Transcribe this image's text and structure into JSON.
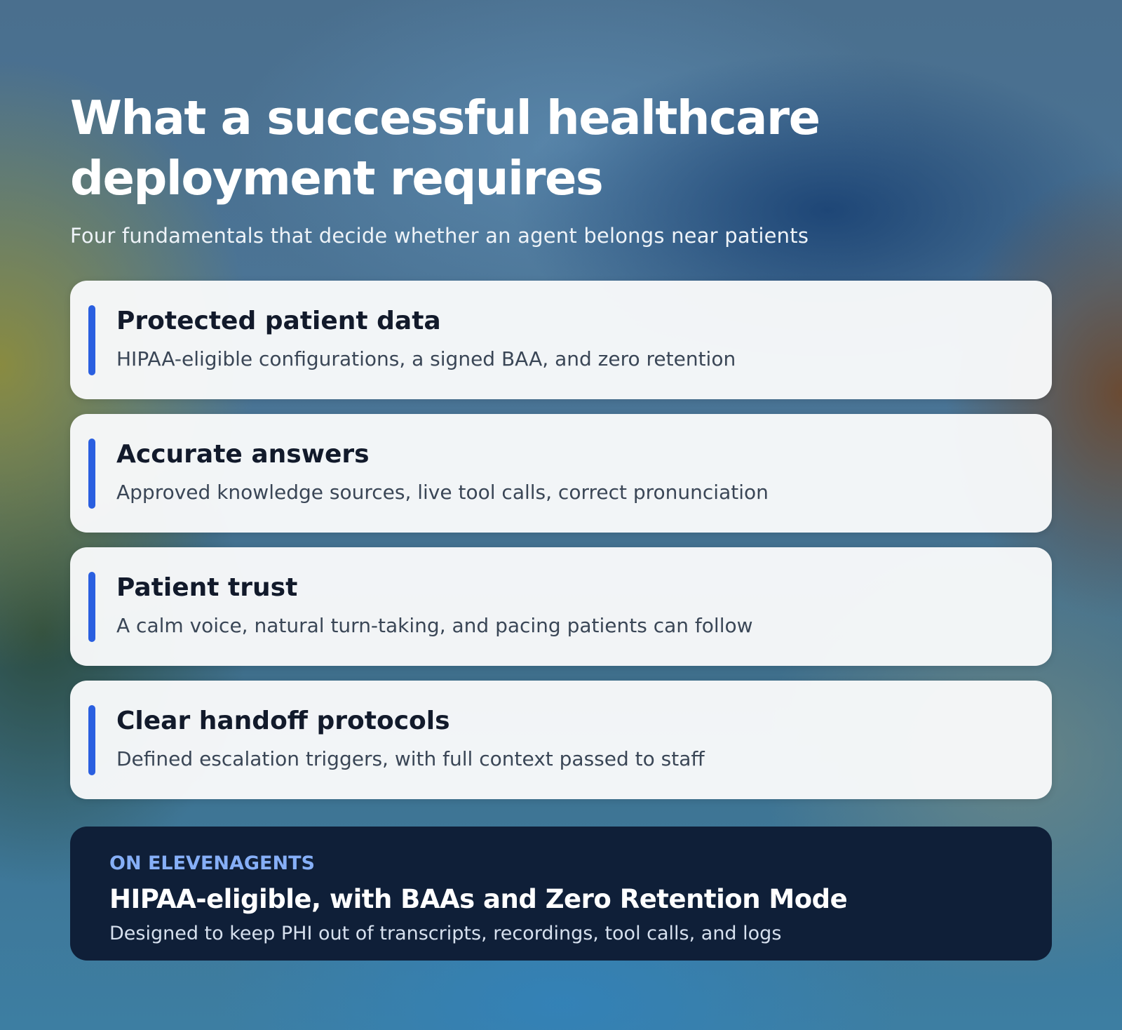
{
  "header": {
    "title": "What a successful healthcare deployment requires",
    "subtitle": "Four fundamentals that decide whether an agent belongs near patients"
  },
  "cards": [
    {
      "title": "Protected patient data",
      "description": "HIPAA-eligible configurations, a signed BAA, and zero retention"
    },
    {
      "title": "Accurate answers",
      "description": "Approved knowledge sources, live tool calls, correct pronunciation"
    },
    {
      "title": "Patient trust",
      "description": "A calm voice, natural turn-taking, and pacing patients can follow"
    },
    {
      "title": "Clear handoff protocols",
      "description": "Defined escalation triggers, with full context passed to staff"
    }
  ],
  "callout": {
    "eyebrow": "ON ELEVENAGENTS",
    "headline": "HIPAA-eligible, with BAAs and Zero Retention Mode",
    "body": "Designed to keep PHI out of transcripts, recordings, tool calls, and logs"
  },
  "colors": {
    "accent_bar": "#2a5fe0",
    "callout_background": "#0f1f38",
    "callout_eyebrow": "#86aff7",
    "card_background": "#f8f9fa"
  }
}
